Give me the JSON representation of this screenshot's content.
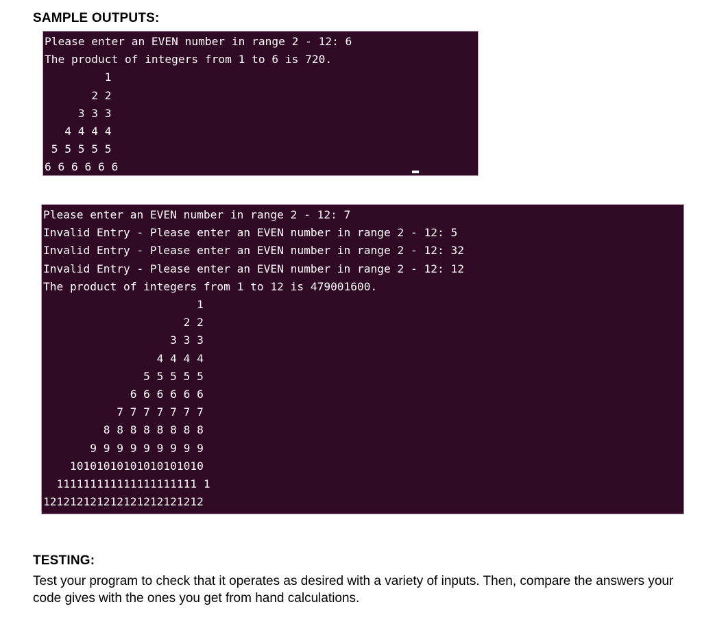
{
  "document": {
    "sections": {
      "sample_outputs": {
        "heading": "SAMPLE OUTPUTS:"
      },
      "testing": {
        "heading": "TESTING:",
        "paragraph": "Test your program to check that it operates as desired with a variety of inputs. Then, compare the answers your code gives with the ones you get from hand calculations."
      }
    }
  },
  "terminals": [
    {
      "id": "terminal-one",
      "background_color": "#300a24",
      "text_color": "#ffffff",
      "border_color": "#b9a3b2",
      "has_cursor": true,
      "prompt_line": "Please enter an EVEN number in range 2 - 12: 6",
      "entered_value": "6",
      "result_line": "The product of integers from 1 to 6 is 720.",
      "product_value": "720",
      "pyramid_rows": [
        "         1",
        "       2 2",
        "     3 3 3",
        "   4 4 4 4",
        " 5 5 5 5 5",
        "6 6 6 6 6 6"
      ],
      "screen_text": "Please enter an EVEN number in range 2 - 12: 6\nThe product of integers from 1 to 6 is 720.\n         1\n       2 2\n     3 3 3\n   4 4 4 4\n 5 5 5 5 5\n6 6 6 6 6 6"
    },
    {
      "id": "terminal-two",
      "background_color": "#300a24",
      "text_color": "#ffffff",
      "border_color": "#b9a3b2",
      "has_cursor": false,
      "prompt_lines": [
        "Please enter an EVEN number in range 2 - 12: 7",
        "Invalid Entry - Please enter an EVEN number in range 2 - 12: 5",
        "Invalid Entry - Please enter an EVEN number in range 2 - 12: 32",
        "Invalid Entry - Please enter an EVEN number in range 2 - 12: 12"
      ],
      "entered_values": [
        "7",
        "5",
        "32",
        "12"
      ],
      "result_line": "The product of integers from 1 to 12 is 479001600.",
      "product_value": "479001600",
      "pyramid_rows": [
        "                       1",
        "                     2 2",
        "                   3 3 3",
        "                 4 4 4 4",
        "               5 5 5 5 5",
        "             6 6 6 6 6 6",
        "           7 7 7 7 7 7 7",
        "         8 8 8 8 8 8 8 8",
        "       9 9 9 9 9 9 9 9 9",
        "    10101010101010101010",
        "  1111111111111111111111",
        "121212121212121212121212"
      ],
      "screen_text": "Please enter an EVEN number in range 2 - 12: 7\nInvalid Entry - Please enter an EVEN number in range 2 - 12: 5\nInvalid Entry - Please enter an EVEN number in range 2 - 12: 32\nInvalid Entry - Please enter an EVEN number in range 2 - 12: 12\nThe product of integers from 1 to 12 is 479001600.\n                       1\n                     2 2\n                   3 3 3\n                 4 4 4 4\n               5 5 5 5 5\n             6 6 6 6 6 6\n           7 7 7 7 7 7 7\n         8 8 8 8 8 8 8 8\n       9 9 9 9 9 9 9 9 9\n    10101010101010101010\n  111111111111111111111 1\n121212121212121212121212"
    }
  ]
}
